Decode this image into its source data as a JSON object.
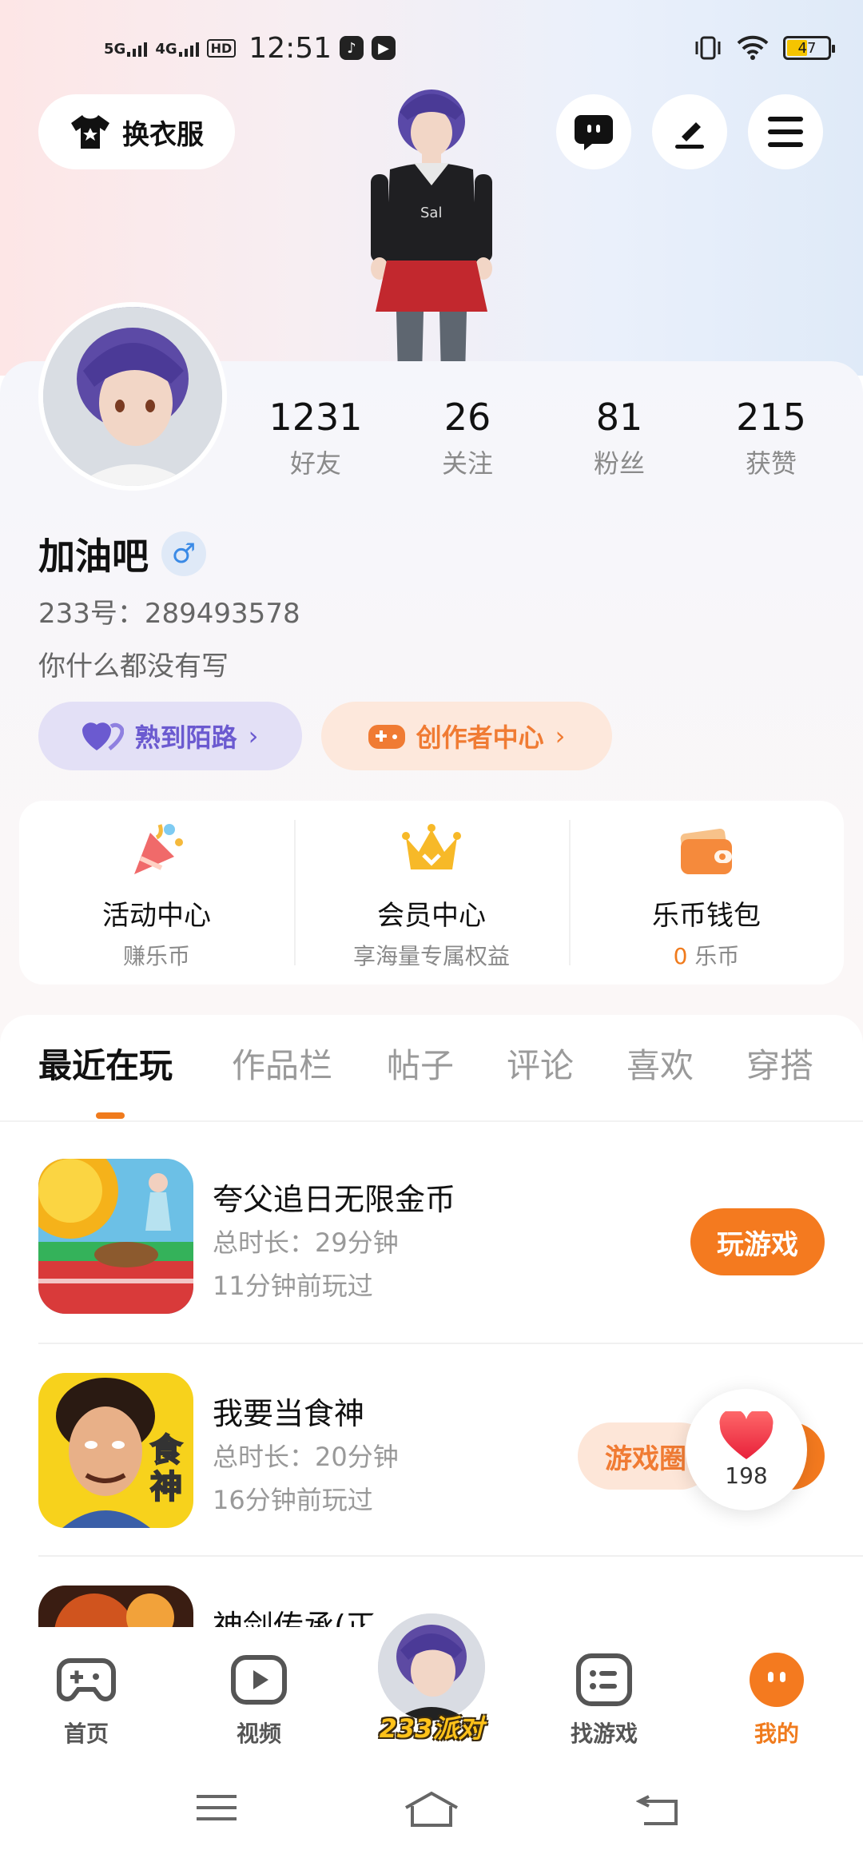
{
  "status_bar": {
    "network1": "5G",
    "network2": "4G",
    "hd": "HD",
    "time": "12:51",
    "battery": "47"
  },
  "header": {
    "outfit_label": "换衣服"
  },
  "profile": {
    "stats": [
      {
        "value": "1231",
        "label": "好友"
      },
      {
        "value": "26",
        "label": "关注"
      },
      {
        "value": "81",
        "label": "粉丝"
      },
      {
        "value": "215",
        "label": "获赞"
      }
    ],
    "username": "加油吧",
    "gender_symbol": "♂",
    "uid": "233号：289493578",
    "bio": "你什么都没有写",
    "pill_friends": "熟到陌路",
    "pill_creator": "创作者中心"
  },
  "features": [
    {
      "title": "活动中心",
      "sub": "赚乐币"
    },
    {
      "title": "会员中心",
      "sub": "享海量专属权益"
    },
    {
      "title": "乐币钱包",
      "sub_value": "0",
      "sub": "乐币"
    }
  ],
  "tabs": [
    "最近在玩",
    "作品栏",
    "帖子",
    "评论",
    "喜欢",
    "穿搭"
  ],
  "games": [
    {
      "name": "夸父追日无限金币",
      "duration": "总时长：29分钟",
      "last_played": "11分钟前玩过",
      "action": "玩游戏"
    },
    {
      "name": "我要当食神",
      "duration": "总时长：20分钟",
      "last_played": "16分钟前玩过",
      "action": "游戏圈"
    },
    {
      "name": "神剑传承(正"
    }
  ],
  "like_float": {
    "count": "198"
  },
  "bottom_nav": {
    "home": "首页",
    "video": "视频",
    "party": "233派对",
    "find": "找游戏",
    "mine": "我的"
  },
  "colors": {
    "accent": "#f47a1f",
    "purple": "#6b5ad0"
  }
}
